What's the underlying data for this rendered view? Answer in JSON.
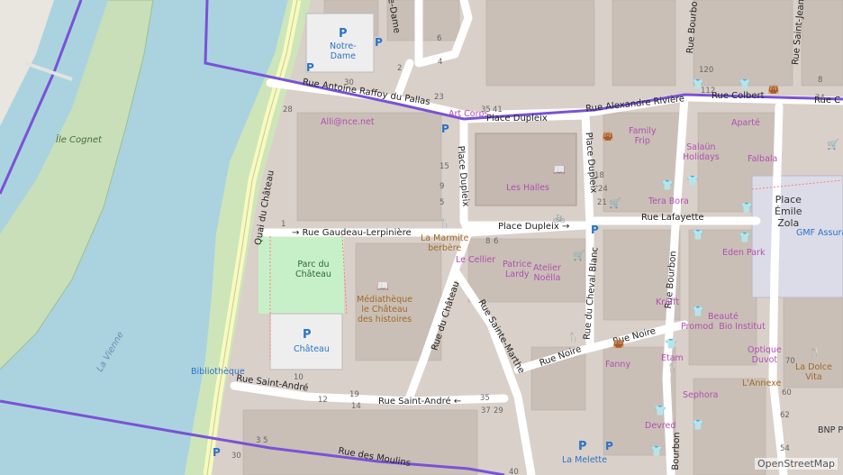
{
  "attribution": "OpenStreetMap",
  "water": {
    "river": "La Vienne",
    "island": "Île Cognet"
  },
  "places": {
    "halles": "Les Halles",
    "place_emile_zola": "Place\nÉmile\nZola"
  },
  "parks": {
    "parc_chateau": "Parc du\nChâteau"
  },
  "streets": {
    "quai_chateau": "Quai du Château",
    "rue_gaudeau": "→ Rue Gaudeau-Lerpinière",
    "place_dupleix_top": "Place Dupleix",
    "place_dupleix_left": "Place Dupleix",
    "place_dupleix_right": "Place Dupleix",
    "place_dupleix_bottom": "Place Dupleix →",
    "rue_antoine": "Rue Antoine Raffoy du Pallas",
    "rue_alexandre": "Rue Alexandre Rivière",
    "rue_colbert": "Rue Colbert",
    "rue_colbert2": "Rue C",
    "rue_lafayette": "Rue Lafayette",
    "rue_bourbon": "Rue Bourbon",
    "rue_bourbon_top": "Rue Bourbo",
    "rue_saint_jean": "Rue Saint-Jean",
    "rue_cheval_blanc": "Rue du Cheval Blanc",
    "rue_chateau": "Rue du Château",
    "rue_sainte_marthe": "Rue Sainte-Marthe",
    "rue_noire": "Rue Noire",
    "rue_noire2": "Rue Noire",
    "rue_saint_andre": "Rue Saint-André",
    "rue_saint_andre2": "Rue Saint-André ←",
    "rue_moulins": "Rue des Moulins",
    "bourbon_bottom": "Bourbon",
    "rue_notre_dame": "re-Dame"
  },
  "pois": {
    "notre_dame_parking": "Notre-\nDame",
    "alliance": "Alli@nce.net",
    "art_corps": "Art Corps",
    "la_marmite": "La Marmite\nberbère",
    "le_cellier": "Le Cellier",
    "patrice_lardy": "Patrice\nLardy",
    "atelier_noella": "Atelier\nNoëlla",
    "mediatheque": "Médiathèque\nle Château\ndes histoires",
    "chateau_parking": "Château",
    "bibliotheque": "Bibliothèque",
    "family_frip": "Family\nFrip",
    "salaun": "Salaün\nHolidays",
    "falbala": "Falbala",
    "aparte": "Aparté",
    "tera_bora": "Tera Bora",
    "eden_park": "Eden Park",
    "gmf": "GMF Assura",
    "krafft": "Krafft",
    "beaute": "Beauté\nPromod  Bio Institut",
    "optique": "Optique\nDuvot",
    "la_dolce": "La Dolce\nVita",
    "fanny": "Fanny",
    "etam": "Etam",
    "sephora": "Sephora",
    "lannexe": "L'Annexe",
    "devred": "Devred",
    "la_melette": "La Melette",
    "bnp": "BNP P"
  },
  "house_numbers": [
    "6",
    "4",
    "2",
    "30",
    "23",
    "28",
    "35",
    "41",
    "15",
    "9",
    "5",
    "1",
    "10",
    "12",
    "19",
    "14",
    "35",
    "37",
    "29",
    "3",
    "5",
    "18",
    "24",
    "21",
    "8",
    "6",
    "120",
    "112",
    "8",
    "24",
    "70",
    "60",
    "62",
    "54",
    "30",
    "40",
    "14",
    "14"
  ],
  "icons": {
    "parking": "P",
    "book": "📖",
    "shop": "👕",
    "restaurant": "🍴",
    "bag": "👜",
    "cart": "🛒",
    "bicycle": "🚲"
  }
}
